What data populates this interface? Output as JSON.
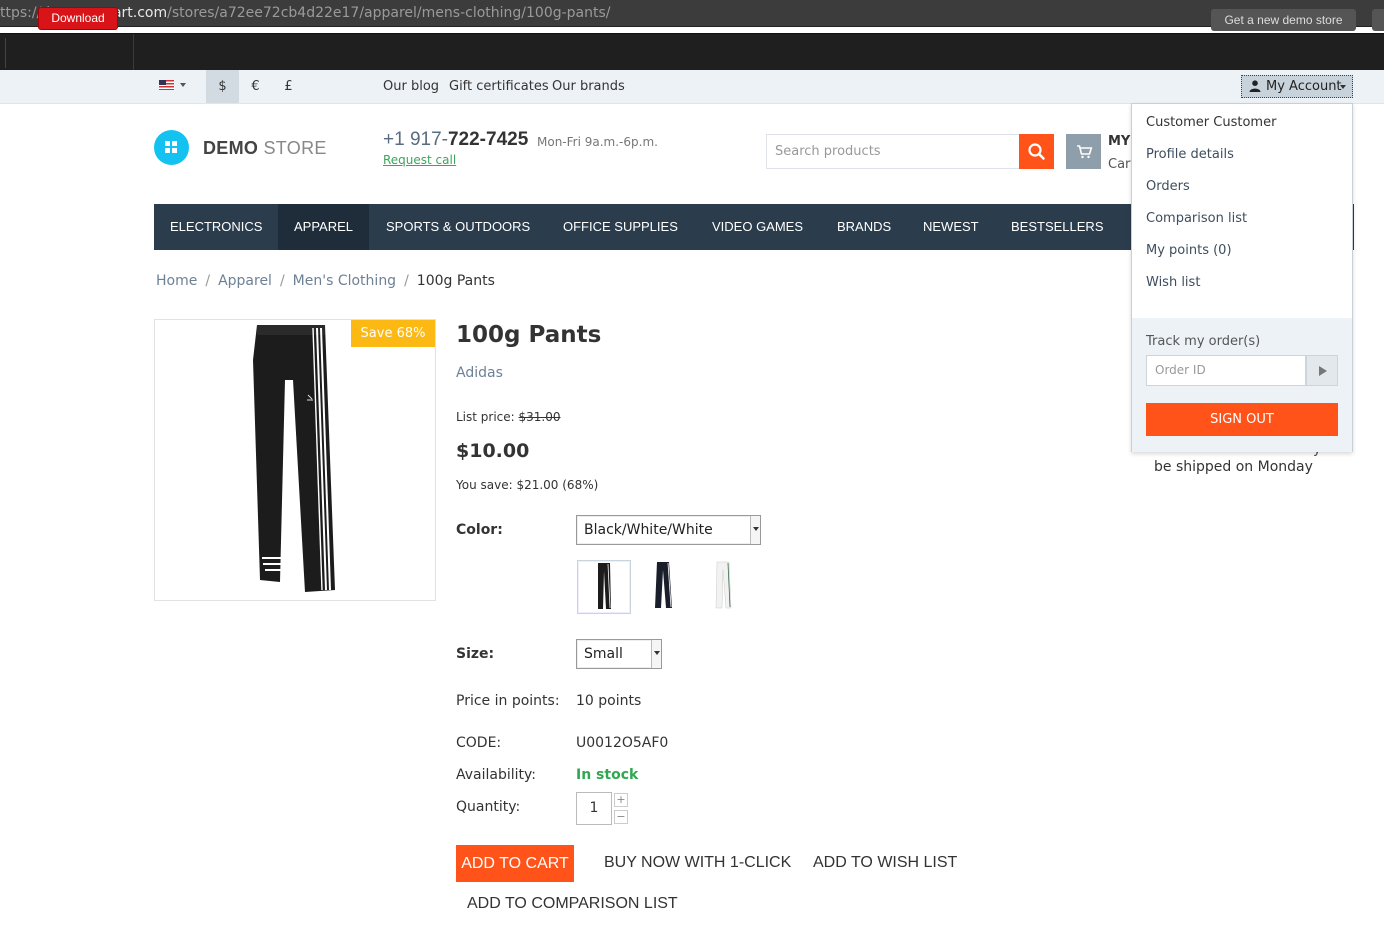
{
  "browser": {
    "url_prefix": "ttps://demo.",
    "url_host": "cs-cart.com",
    "url_path": "/stores/a72ee72cb4d22e17/apparel/mens-clothing/100g-pants/"
  },
  "demobar": {
    "download_label": "Download",
    "new_demo_label": "Get a new demo store"
  },
  "toppanel": {
    "currencies": [
      "$",
      "€",
      "£"
    ],
    "links": [
      "Our blog",
      "Gift certificates",
      "Our brands"
    ],
    "account_label": "My Account"
  },
  "header": {
    "logo_bold": "DEMO",
    "logo_light": " STORE",
    "phone_prefix": "+1 917-",
    "phone_main": "722-7425",
    "phone_hours": "Mon-Fri 9a.m.-6p.m.",
    "request_call": "Request call",
    "search_placeholder": "Search products",
    "cart_title": "MY",
    "cart_sub": "Cart"
  },
  "nav": {
    "items": [
      "ELECTRONICS",
      "APPAREL",
      "SPORTS & OUTDOORS",
      "OFFICE SUPPLIES",
      "VIDEO GAMES",
      "BRANDS",
      "NEWEST",
      "BESTSELLERS"
    ]
  },
  "breadcrumbs": [
    "Home",
    "Apparel",
    "Men's Clothing",
    "100g Pants"
  ],
  "product": {
    "save_badge": "Save 68%",
    "title": "100g Pants",
    "brand": "Adidas",
    "list_price_label": "List price: ",
    "list_price": "$31.00",
    "price": "$10.00",
    "you_save": "You save: $21.00 (68%)",
    "color_label": "Color:",
    "color_value": "Black/White/White",
    "size_label": "Size:",
    "size_value": "Small",
    "points_label": "Price in points:",
    "points_value": "10 points",
    "code_label": "CODE:",
    "code_value": "U0012O5AF0",
    "availability_label": "Availability:",
    "availability_value": "In stock",
    "quantity_label": "Quantity:",
    "quantity_value": "1",
    "qty_plus": "+",
    "qty_minus": "−",
    "add_to_cart": "ADD TO CART",
    "buy_now": "BUY NOW WITH 1-CLICK",
    "add_wishlist": "ADD TO WISH LIST",
    "add_comparison": "ADD TO COMPARISON LIST"
  },
  "side": {
    "ship_note": "be shipped on Monday",
    "tail_char": "y"
  },
  "account_menu": {
    "user_name": "Customer Customer",
    "items": [
      "Profile details",
      "Orders",
      "Comparison list",
      "My points (0)",
      "Wish list"
    ],
    "track_label": "Track my order(s)",
    "order_placeholder": "Order ID",
    "sign_out": "SIGN OUT"
  },
  "colors": {
    "accent": "#ff5319",
    "nav_bg": "#2b3c4d",
    "logo": "#14c2f2",
    "badge": "#fcb813",
    "in_stock": "#2fa84f"
  }
}
